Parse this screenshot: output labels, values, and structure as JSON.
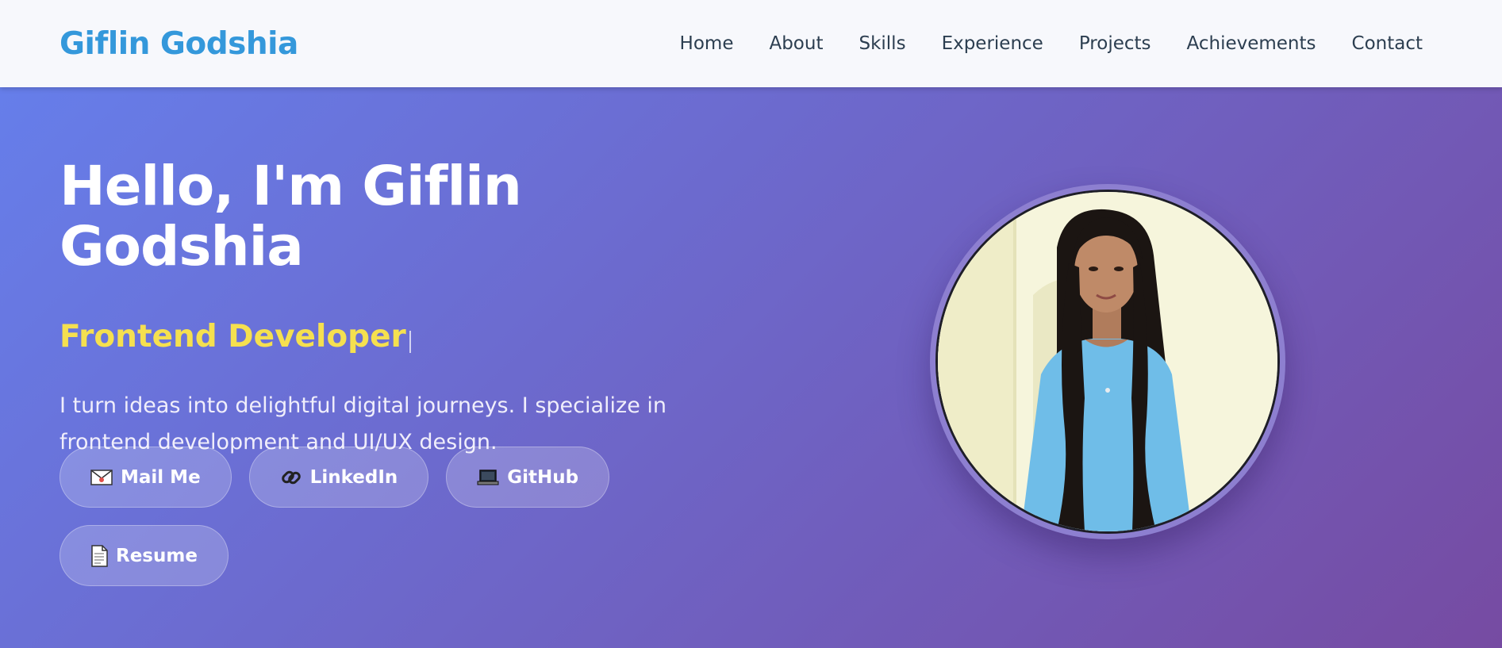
{
  "nav": {
    "brand": "Giflin Godshia",
    "links": [
      "Home",
      "About",
      "Skills",
      "Experience",
      "Projects",
      "Achievements",
      "Contact"
    ]
  },
  "hero": {
    "title": "Hello, I'm Giflin Godshia",
    "subtitle": "Frontend Developer",
    "description": "I turn ideas into delightful digital journeys. I specialize in frontend development and UI/UX design.",
    "buttons": [
      {
        "label": "Mail Me",
        "icon": "envelope-icon"
      },
      {
        "label": "LinkedIn",
        "icon": "link-icon"
      },
      {
        "label": "GitHub",
        "icon": "laptop-icon"
      },
      {
        "label": "Resume",
        "icon": "document-icon"
      }
    ]
  },
  "colors": {
    "brand": "#3498db",
    "nav_text": "#2c3e50",
    "gradient_start": "#667eea",
    "gradient_end": "#764ba2",
    "subtitle": "#f5e04f"
  }
}
